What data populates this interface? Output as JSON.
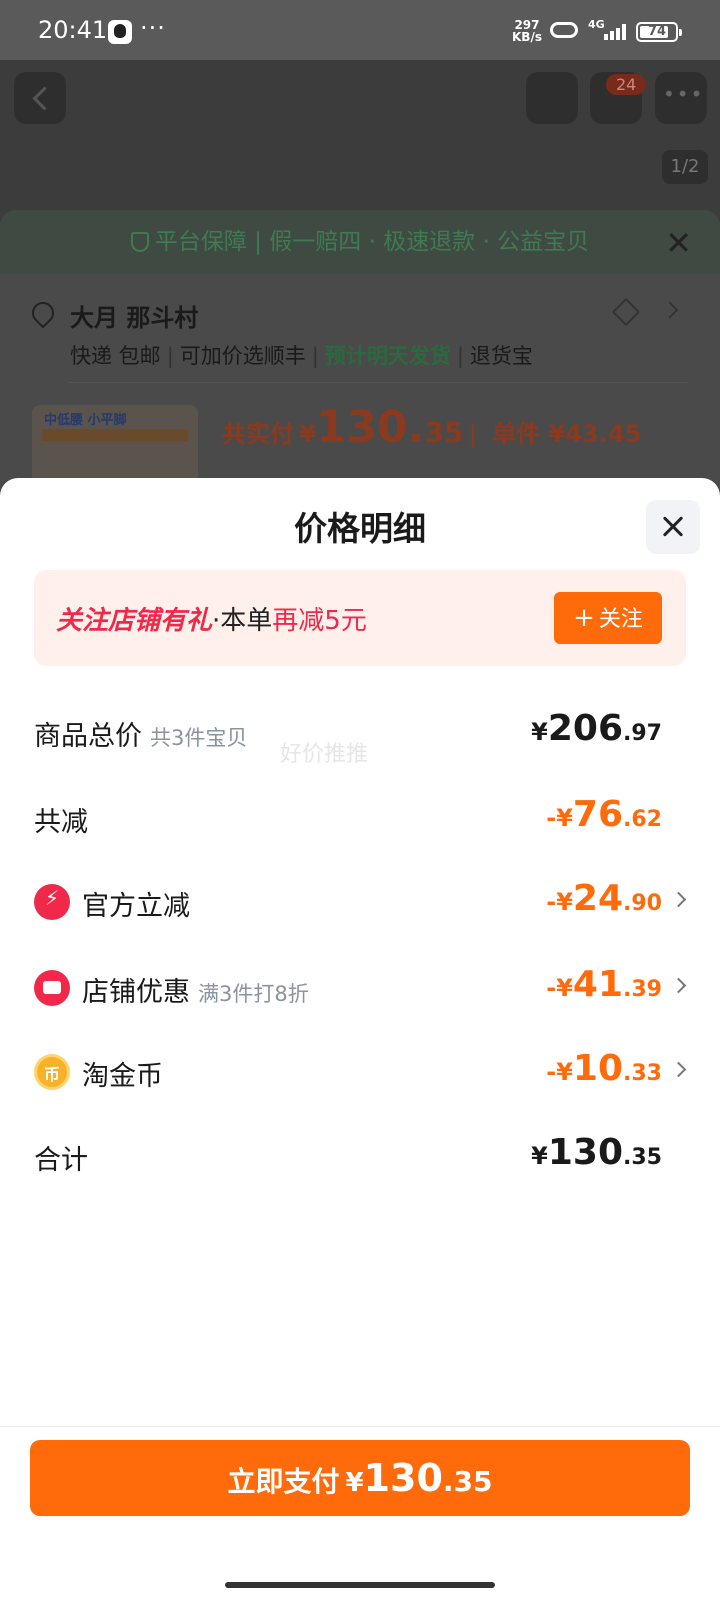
{
  "status_bar": {
    "time": "20:41",
    "dots": "···",
    "net_speed_value": "297",
    "net_speed_unit": "KB/s",
    "network": "4G",
    "battery": "74"
  },
  "background_page": {
    "cart_badge": "24",
    "page_indicator": "1/2",
    "guarantee": "平台保障 | 假一赔四 · 极速退款 · 公益宝贝",
    "address_name": "大月 那斗村",
    "shipping": {
      "express": "快递 包邮",
      "shunfeng": "可加价选顺丰",
      "eta": "预计明天发货",
      "return": "退货宝",
      "sep": "|"
    },
    "product_tag": "中低腰 小平脚",
    "pay_label": "共实付",
    "pay_currency": "¥",
    "pay_int": "130.",
    "pay_dec": "35",
    "pay_sep": "|",
    "unit_price": "单件 ¥43.45"
  },
  "modal": {
    "title": "价格明细",
    "follow_banner": {
      "highlight": "关注店铺有礼",
      "dot": "·",
      "text": "本单",
      "discount": "再减5元",
      "button_plus": "+",
      "button_label": "关注"
    },
    "watermark": "好价推推",
    "rows": [
      {
        "label": "商品总价",
        "sub": "共3件宝贝",
        "currency": "¥",
        "int": "206",
        "dec": ".97"
      },
      {
        "label": "共减",
        "sub": "",
        "currency": "-¥",
        "int": "76",
        "dec": ".62"
      },
      {
        "label": "官方立减",
        "sub": "",
        "currency": "-¥",
        "int": "24",
        "dec": ".90",
        "icon": "flash-icon"
      },
      {
        "label": "店铺优惠",
        "sub": "满3件打8折",
        "currency": "-¥",
        "int": "41",
        "dec": ".39",
        "icon": "shop-icon"
      },
      {
        "label": "淘金币",
        "sub": "",
        "currency": "-¥",
        "int": "10",
        "dec": ".33",
        "icon": "coin-icon"
      },
      {
        "label": "合计",
        "sub": "",
        "currency": "¥",
        "int": "130",
        "dec": ".35"
      }
    ],
    "pay_button": {
      "label": "立即支付",
      "currency": "¥",
      "int": "130",
      "dec": ".35"
    }
  },
  "colors": {
    "accent_orange": "#ff6a0a",
    "accent_red": "#f0284a",
    "guarantee_green": "#3f7a52"
  }
}
